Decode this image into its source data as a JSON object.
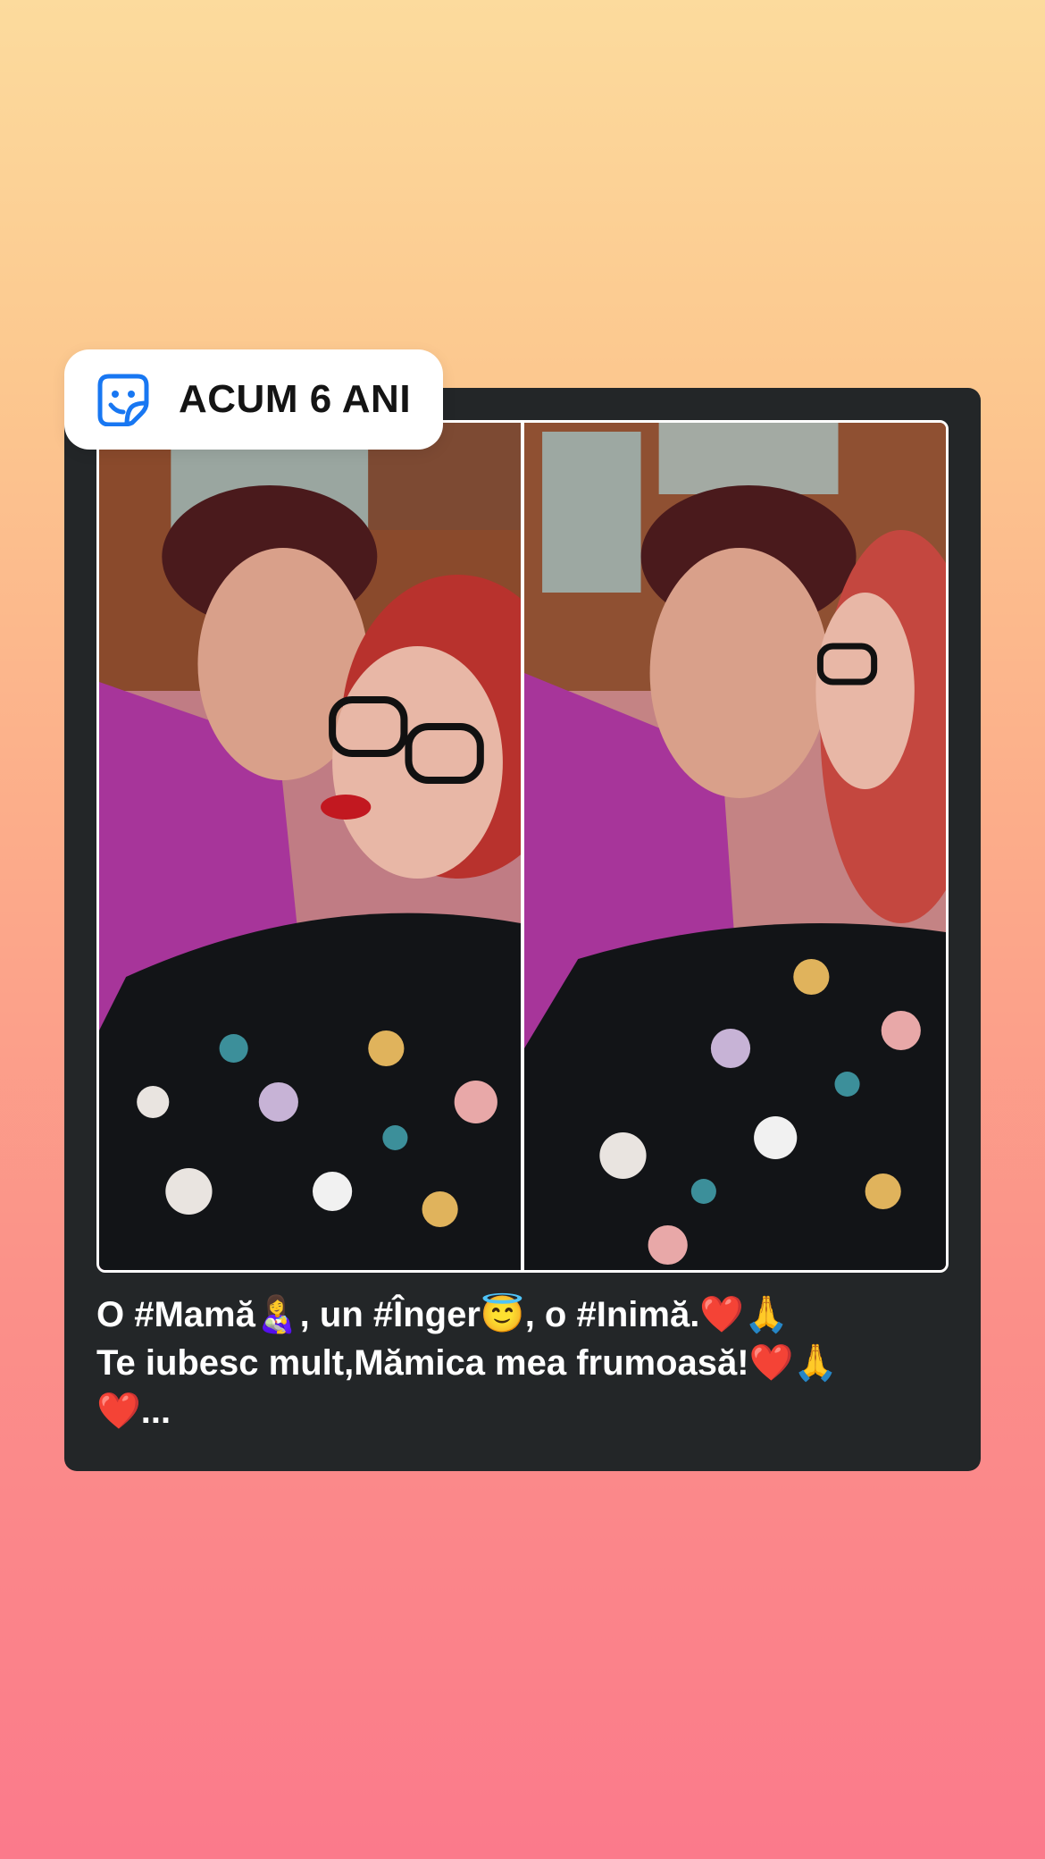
{
  "memory_badge": {
    "icon": "sticker-smiley-icon",
    "label": "ACUM 6 ANI",
    "accent_color": "#1877f2"
  },
  "post": {
    "photos": [
      {
        "description": "photo-left"
      },
      {
        "description": "photo-right"
      }
    ],
    "caption_lines": [
      "O #Mamă👩‍🍼, un #Înger😇, o #Inimă.❤️🙏",
      "Te iubesc mult,Mămica mea frumoasă!❤️🙏",
      "❤️..."
    ]
  },
  "colors": {
    "background_top": "#fcdb9d",
    "background_bottom": "#fb7a8b",
    "card": "#232628",
    "text": "#ffffff"
  }
}
